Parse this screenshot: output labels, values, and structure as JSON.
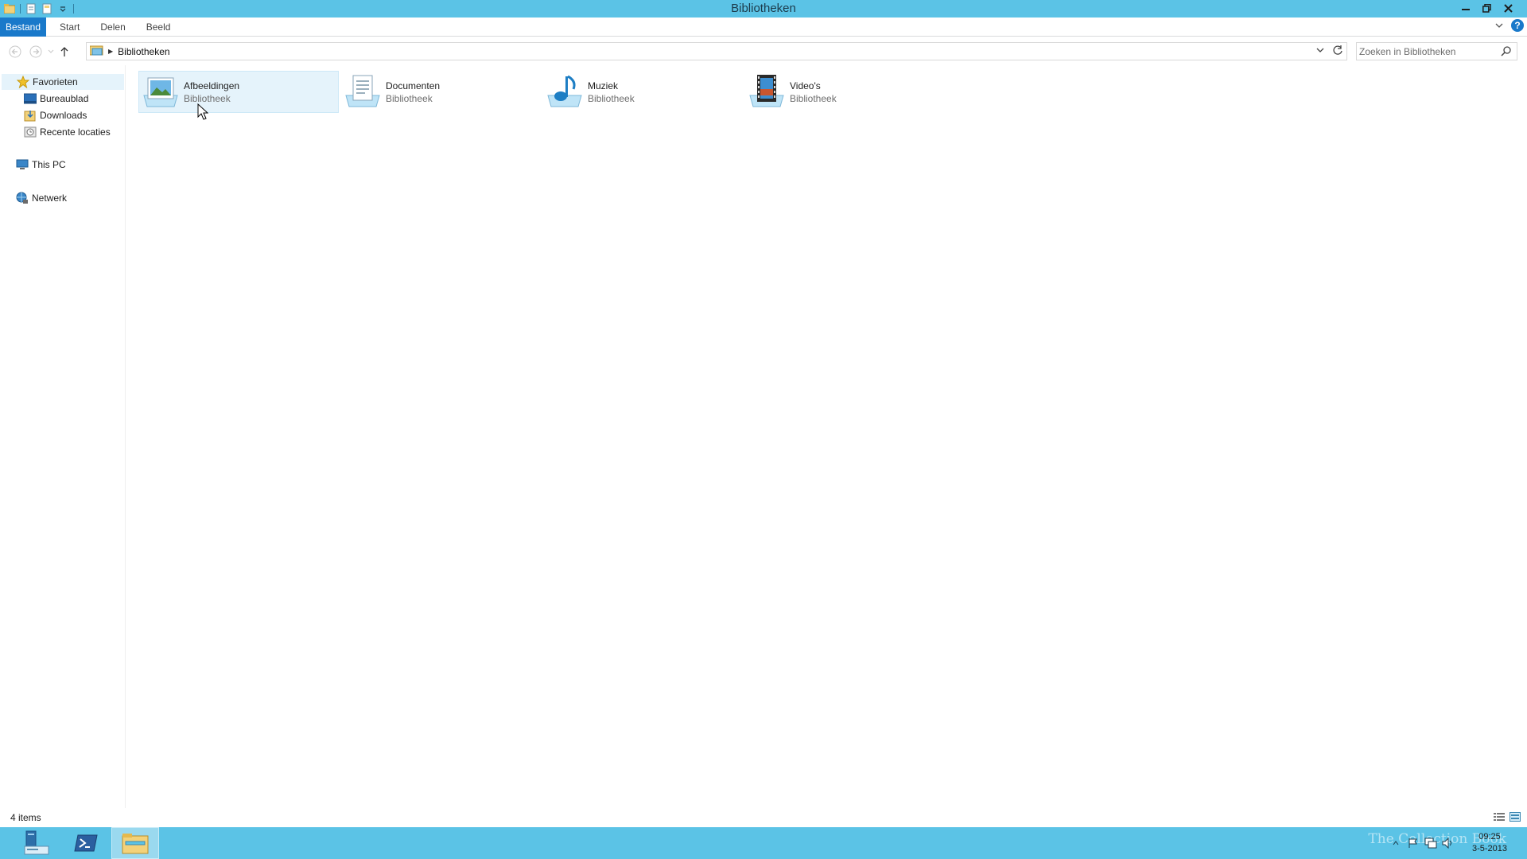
{
  "window": {
    "title": "Bibliotheken"
  },
  "ribbon": {
    "tabs": [
      "Bestand",
      "Start",
      "Delen",
      "Beeld"
    ]
  },
  "address": {
    "crumbs": [
      "Bibliotheken"
    ],
    "search_placeholder": "Zoeken in Bibliotheken"
  },
  "navigation": {
    "favorites_label": "Favorieten",
    "favorites": [
      "Bureaublad",
      "Downloads",
      "Recente locaties"
    ],
    "this_pc": "This PC",
    "network": "Netwerk"
  },
  "libraries": [
    {
      "name": "Afbeeldingen",
      "type": "Bibliotheek",
      "icon": "pictures-library-icon",
      "selected": true
    },
    {
      "name": "Documenten",
      "type": "Bibliotheek",
      "icon": "documents-library-icon",
      "selected": false
    },
    {
      "name": "Muziek",
      "type": "Bibliotheek",
      "icon": "music-library-icon",
      "selected": false
    },
    {
      "name": "Video's",
      "type": "Bibliotheek",
      "icon": "videos-library-icon",
      "selected": false
    }
  ],
  "status": {
    "item_count": "4 items"
  },
  "taskbar": {
    "clock_time": "09:25",
    "clock_date": "3-5-2013",
    "watermark": "The Collection Book"
  },
  "colors": {
    "titlebar": "#5bc3e6",
    "file_tab": "#1979ca",
    "selection": "#e5f3fb"
  }
}
